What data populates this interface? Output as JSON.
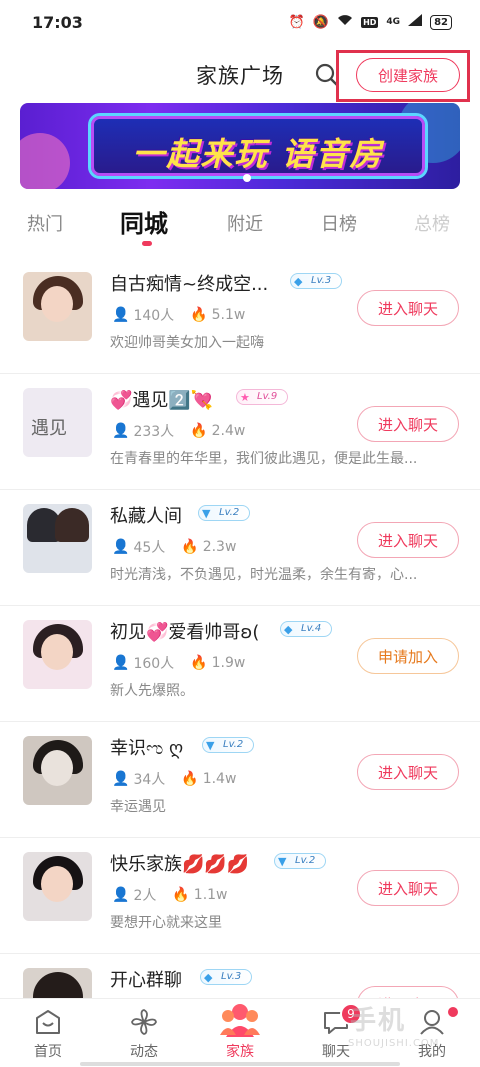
{
  "status_bar": {
    "time": "17:03",
    "network": "4G",
    "battery": "82"
  },
  "header": {
    "title": "家族广场",
    "create_label": "创建家族"
  },
  "banner": {
    "text": "一起来玩 语音房"
  },
  "tabs": [
    "热门",
    "同城",
    "附近",
    "日榜",
    "总榜"
  ],
  "families": [
    {
      "name": "自古痴情~终成空...",
      "level": "Lv.3",
      "members": "140人",
      "heat": "5.1w",
      "desc": "欢迎帅哥美女加入一起嗨",
      "action": "进入聊天"
    },
    {
      "name": "💞遇见2️⃣💘",
      "level": "Lv.9",
      "members": "233人",
      "heat": "2.4w",
      "desc": "在青春里的年华里，我们彼此遇见，便是此生最...",
      "action": "进入聊天"
    },
    {
      "name": "私藏人间",
      "level": "Lv.2",
      "members": "45人",
      "heat": "2.3w",
      "desc": "时光清浅，不负遇见，时光温柔，余生有寄，心...",
      "action": "进入聊天"
    },
    {
      "name": "初见💞爱看帅哥ʚ(",
      "level": "Lv.4",
      "members": "160人",
      "heat": "1.9w",
      "desc": "新人先爆照。",
      "action": "申请加入"
    },
    {
      "name": "幸识ಌ ღ",
      "level": "Lv.2",
      "members": "34人",
      "heat": "1.4w",
      "desc": "幸运遇见",
      "action": "进入聊天"
    },
    {
      "name": "快乐家族💋💋💋",
      "level": "Lv.2",
      "members": "2人",
      "heat": "1.1w",
      "desc": "要想开心就来这里",
      "action": "进入聊天"
    },
    {
      "name": "开心群聊",
      "level": "Lv.3",
      "members": "",
      "heat": "",
      "desc": "",
      "action": "进入聊天"
    }
  ],
  "tabbar": {
    "home": "首页",
    "moments": "动态",
    "family": "家族",
    "chat": "聊天",
    "chat_badge": "9",
    "me": "我的"
  },
  "watermark": {
    "main": "手机",
    "sub": "SHOUJISHI.COM"
  },
  "colors": {
    "accent": "#ef3a5d",
    "apply": "#e67a1e"
  }
}
